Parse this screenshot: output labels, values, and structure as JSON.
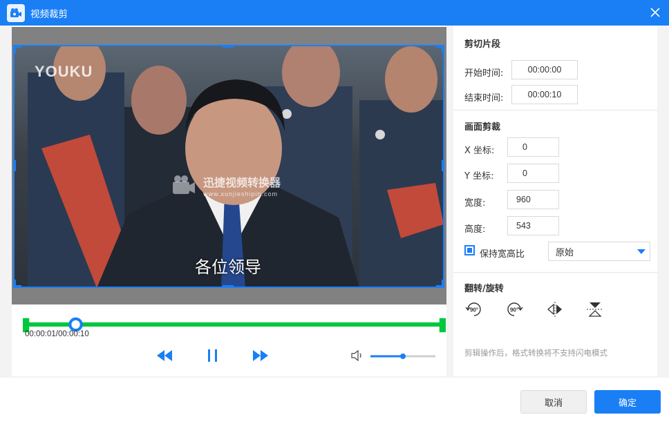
{
  "window": {
    "title": "视频裁剪"
  },
  "video": {
    "watermark_logo": "YOUKU",
    "watermark_cn": "迅捷视频转换器",
    "watermark_url": "www.xunjieshipin.com",
    "subtitle": "各位领导"
  },
  "playback": {
    "time": "00:00:01/00:00:10",
    "progress": 0.12,
    "volume": 0.5
  },
  "clip": {
    "title": "剪切片段",
    "start_label": "开始时间:",
    "start_value": "00:00:00",
    "end_label": "结束时间:",
    "end_value": "00:00:10"
  },
  "crop": {
    "title": "画面剪裁",
    "x_label": "X 坐标:",
    "x_value": "0",
    "y_label": "Y 坐标:",
    "y_value": "0",
    "width_label": "宽度:",
    "width_value": "960",
    "height_label": "高度:",
    "height_value": "543",
    "keep_ratio_label": "保持宽高比",
    "keep_ratio_checked": true,
    "ratio_selected": "原始"
  },
  "rotate": {
    "title": "翻转/旋转",
    "rotate_left_label": "90°",
    "rotate_right_label": "90°"
  },
  "hint": "剪辑操作后，格式转换将不支持闪电模式",
  "buttons": {
    "cancel": "取消",
    "ok": "确定"
  },
  "colors": {
    "accent": "#1a7ff5",
    "timeline": "#00c83c"
  }
}
